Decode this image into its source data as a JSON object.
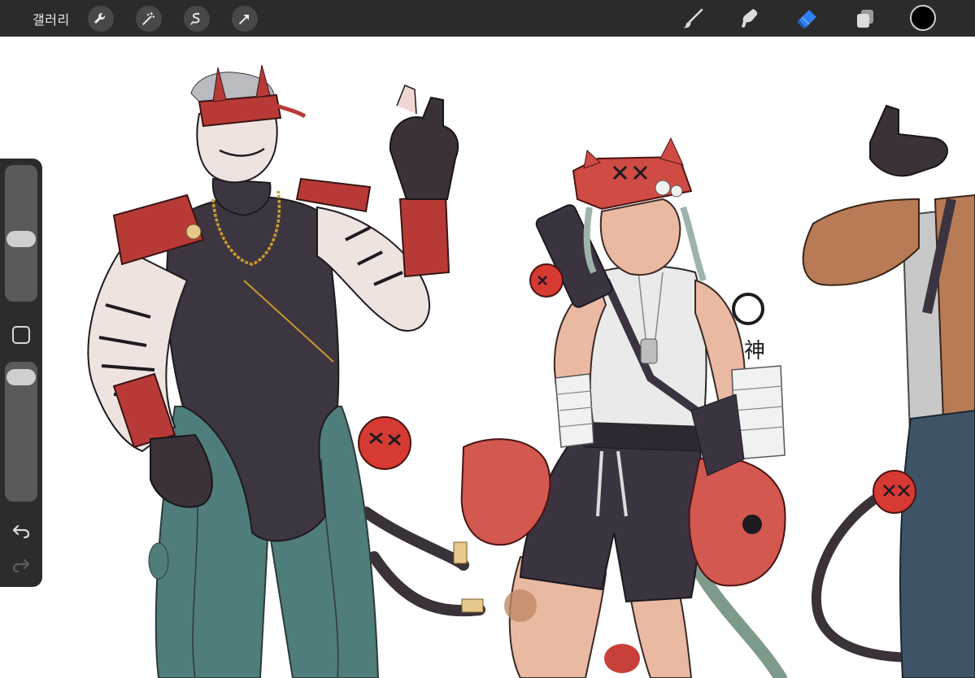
{
  "topbar": {
    "gallery_label": "갤러리",
    "left_tools": [
      "wrench-icon",
      "magic-wand-icon",
      "selection-icon",
      "transform-arrow-icon"
    ],
    "right_tools": [
      "brush-icon",
      "smudge-icon",
      "eraser-icon",
      "layers-icon"
    ],
    "active_tool": "eraser-icon",
    "active_color": "#000000",
    "accent_color": "#2f80ed"
  },
  "sidebar": {
    "brush_size_level": 0.45,
    "opacity_level": 0.95
  },
  "canvas": {
    "background": "#ffffff"
  }
}
